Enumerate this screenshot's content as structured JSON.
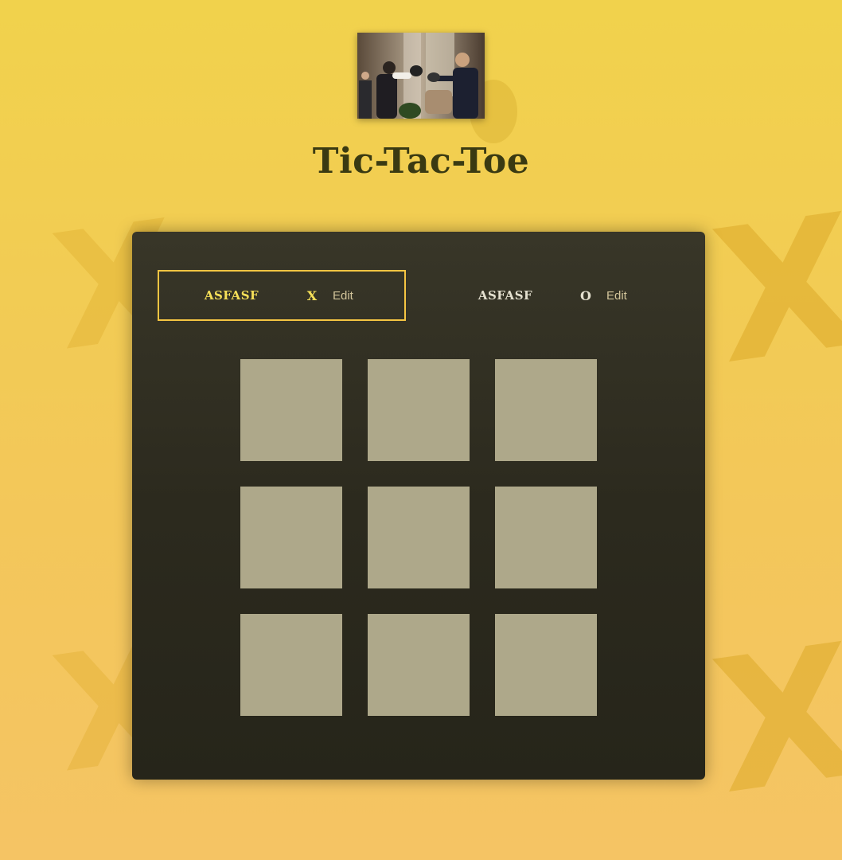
{
  "header": {
    "title": "Tic-Tac-Toe",
    "logo_alt": "Game logo photo"
  },
  "players": [
    {
      "name": "ASFASF",
      "symbol": "X",
      "edit_label": "Edit",
      "active": true
    },
    {
      "name": "ASFASF",
      "symbol": "O",
      "edit_label": "Edit",
      "active": false
    }
  ],
  "board": {
    "cells": [
      [
        "",
        "",
        ""
      ],
      [
        "",
        "",
        ""
      ],
      [
        "",
        "",
        ""
      ]
    ]
  },
  "colors": {
    "background": "#f1d24c",
    "panel": "#2c2a1e",
    "cell": "#aea88a",
    "active_border": "#f5c542",
    "title": "#3a3a12"
  }
}
